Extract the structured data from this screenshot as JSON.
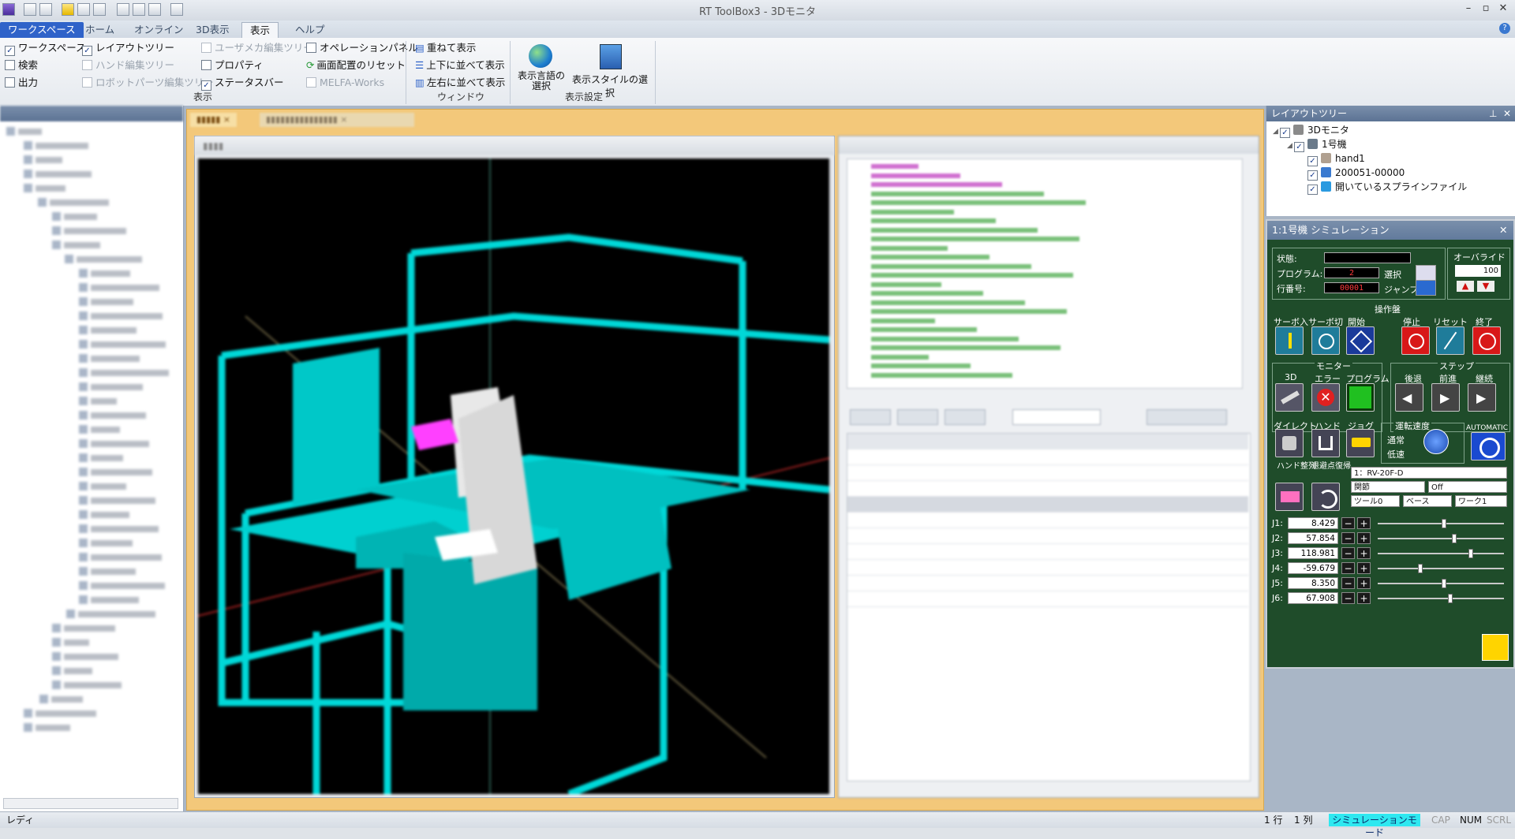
{
  "app": {
    "title": "RT ToolBox3 - 3Dモニタ"
  },
  "menu": {
    "workspace": "ワークスペース",
    "home": "ホーム",
    "online": "オンライン",
    "display3d": "3D表示",
    "view": "表示",
    "help": "ヘルプ"
  },
  "ribbon": {
    "workspace": "ワークスペース",
    "layout_tree": "レイアウトツリー",
    "user_mecha_tree": "ユーザメカ編集ツリー",
    "operation_panel": "オペレーションパネル",
    "search": "検索",
    "hand_edit_tree": "ハンド編集ツリー",
    "property": "プロパティ",
    "reset_layout": "画面配置のリセット",
    "output": "出力",
    "robot_parts_tree": "ロボットパーツ編集ツリー",
    "status_bar": "ステータスバー",
    "melfa_works": "MELFA-Works",
    "group_display": "表示",
    "cascade": "重ねて表示",
    "tile_vertical": "上下に並べて表示",
    "tile_horizontal": "左右に並べて表示",
    "group_window": "ウィンドウ",
    "select_language_1": "表示言語の",
    "select_language_2": "選択",
    "select_style": "表示スタイルの選択",
    "group_display_settings": "表示設定"
  },
  "layout_tree": {
    "title": "レイアウトツリー",
    "items": [
      {
        "label": "3Dモニタ"
      },
      {
        "label": "1号機"
      },
      {
        "label": "hand1"
      },
      {
        "label": "200051-00000"
      },
      {
        "label": "開いているスプラインファイル"
      }
    ]
  },
  "sim": {
    "title": "1:1号機  シミュレーション",
    "state_label": "状態:",
    "program_label": "プログラム:",
    "program_value": "2",
    "select_label": "選択",
    "line_label": "行番号:",
    "line_value": "00001",
    "jump_label": "ジャンプ",
    "override_label": "オーバライド",
    "override_value": "100",
    "ops_label": "操作盤",
    "servo_on": "サーボ入",
    "servo_off": "サーボ切",
    "start": "開始",
    "stop": "停止",
    "reset": "リセット",
    "end": "終了",
    "monitor_label": "モニター",
    "m3d": "3D",
    "error": "エラー",
    "program": "プログラム",
    "step_label": "ステップ",
    "back": "後退",
    "forward": "前進",
    "continue": "継続",
    "direct": "ダイレクト",
    "hand": "ハンド",
    "jog": "ジョグ",
    "run_speed": "運転速度",
    "normal": "通常",
    "slow": "低速",
    "automatic": "AUTOMATIC",
    "hand_align": "ハンド整列",
    "retreat": "退避点復帰",
    "robot": "1：RV-20F-D",
    "mode": "関節",
    "mode_value": "Off",
    "tool": "ツール0",
    "base": "ベース",
    "work": "ワーク1",
    "joints": [
      {
        "name": "J1:",
        "value": "8.429",
        "pos": 0.52
      },
      {
        "name": "J2:",
        "value": "57.854",
        "pos": 0.6
      },
      {
        "name": "J3:",
        "value": "118.981",
        "pos": 0.74
      },
      {
        "name": "J4:",
        "value": "-59.679",
        "pos": 0.33
      },
      {
        "name": "J5:",
        "value": "8.350",
        "pos": 0.52
      },
      {
        "name": "J6:",
        "value": "67.908",
        "pos": 0.57
      }
    ]
  },
  "status": {
    "left": "レディ",
    "row": "1 行",
    "col": "1 列",
    "mode": "シミュレーションモード",
    "cap": "CAP",
    "num": "NUM",
    "scrl": "SCRL"
  },
  "colors": {
    "accent": "#2f63c9",
    "frame": "#00d8d8",
    "sim_bg": "#1f4c2a"
  }
}
